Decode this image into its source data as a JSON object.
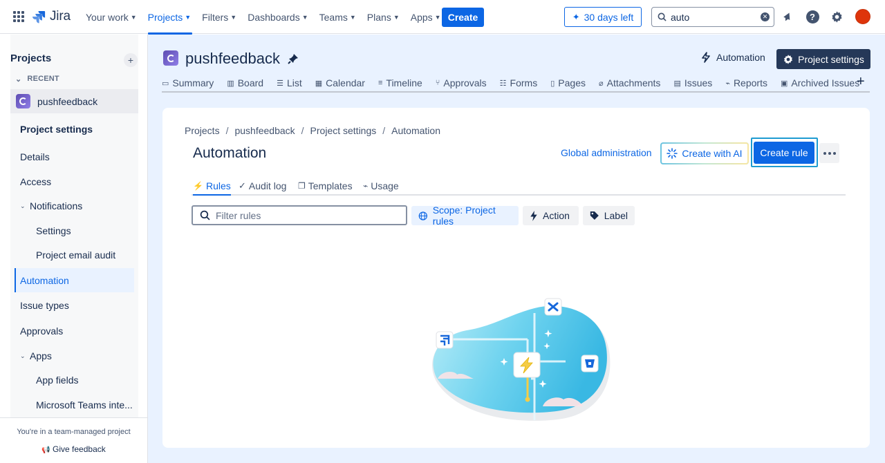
{
  "topnav": {
    "logo": "Jira",
    "items": [
      {
        "label": "Your work",
        "chevron": true
      },
      {
        "label": "Projects",
        "chevron": true,
        "active": true
      },
      {
        "label": "Filters",
        "chevron": true
      },
      {
        "label": "Dashboards",
        "chevron": true
      },
      {
        "label": "Teams",
        "chevron": true
      },
      {
        "label": "Plans",
        "chevron": true
      },
      {
        "label": "Apps",
        "chevron": true
      }
    ],
    "create_label": "Create",
    "trial_label": "30 days left",
    "search_value": "auto"
  },
  "sidebar": {
    "header": "Projects",
    "recent_label": "RECENT",
    "project_name": "pushfeedback",
    "items": [
      {
        "label": "Project settings",
        "style": "bold"
      },
      {
        "label": "Details"
      },
      {
        "label": "Access"
      },
      {
        "label": "Notifications",
        "chevron": true
      },
      {
        "label": "Settings",
        "indent": true
      },
      {
        "label": "Project email audit",
        "indent": true
      },
      {
        "label": "Automation",
        "active": true
      },
      {
        "label": "Issue types"
      },
      {
        "label": "Approvals"
      },
      {
        "label": "Apps",
        "chevron": true
      },
      {
        "label": "App fields",
        "indent": true
      },
      {
        "label": "Microsoft Teams inte...",
        "indent": true
      }
    ],
    "footer_note": "You're in a team-managed project",
    "feedback_label": "Give feedback"
  },
  "project": {
    "title": "pushfeedback",
    "automation_label": "Automation",
    "settings_label": "Project settings",
    "tabs": [
      {
        "label": "Summary",
        "icon": "summary-icon",
        "glyph": "▭"
      },
      {
        "label": "Board",
        "icon": "board-icon",
        "glyph": "▥"
      },
      {
        "label": "List",
        "icon": "list-icon",
        "glyph": "☰"
      },
      {
        "label": "Calendar",
        "icon": "calendar-icon",
        "glyph": "▦"
      },
      {
        "label": "Timeline",
        "icon": "timeline-icon",
        "glyph": "≡"
      },
      {
        "label": "Approvals",
        "icon": "approvals-icon",
        "glyph": "⑂"
      },
      {
        "label": "Forms",
        "icon": "forms-icon",
        "glyph": "☷"
      },
      {
        "label": "Pages",
        "icon": "pages-icon",
        "glyph": "▯"
      },
      {
        "label": "Attachments",
        "icon": "attachment-icon",
        "glyph": "⌀"
      },
      {
        "label": "Issues",
        "icon": "issues-icon",
        "glyph": "▤"
      },
      {
        "label": "Reports",
        "icon": "reports-icon",
        "glyph": "⌁"
      },
      {
        "label": "Archived Issues",
        "icon": "archive-icon",
        "glyph": "▣"
      }
    ]
  },
  "automation": {
    "breadcrumbs": [
      "Projects",
      "pushfeedback",
      "Project settings",
      "Automation"
    ],
    "title": "Automation",
    "global_admin_label": "Global administration",
    "create_ai_label": "Create with AI",
    "create_rule_label": "Create rule",
    "subtabs": [
      "Rules",
      "Audit log",
      "Templates",
      "Usage"
    ],
    "filter_placeholder": "Filter rules",
    "scope_label": "Scope: Project rules",
    "action_label": "Action",
    "label_label": "Label"
  },
  "colors": {
    "brand": "#0c66e4",
    "nav_dark": "#253858",
    "main_bg": "#e9f2ff",
    "avatar": "#de350b"
  }
}
